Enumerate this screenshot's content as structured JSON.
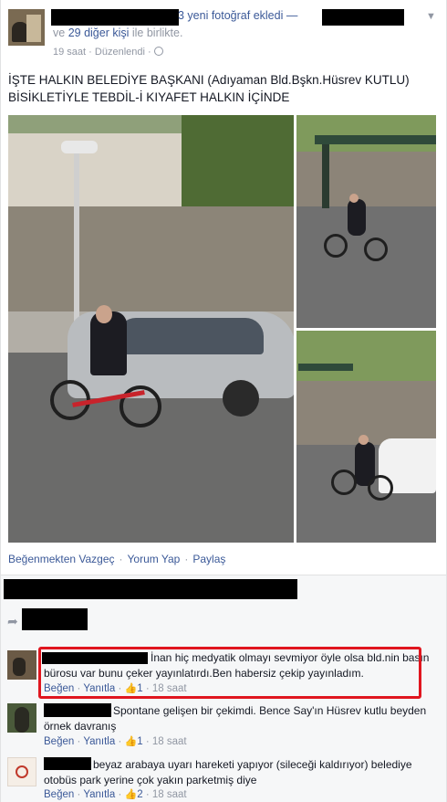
{
  "post": {
    "header_action": "3 yeni fotoğraf ekledi —",
    "with_prefix": "ve",
    "with_count": "29 diğer kişi",
    "with_suffix": "ile birlikte.",
    "time": "19 saat",
    "meta_sep": "·",
    "edited": "Düzenlendi",
    "text": "İŞTE HALKIN BELEDİYE BAŞKANI (Adıyaman Bld.Bşkn.Hüsrev KUTLU) BİSİKLETİYLE TEBDİL-İ KIYAFET HALKIN İÇİNDE",
    "actions": {
      "unlike": "Beğenmekten Vazgeç",
      "comment": "Yorum Yap",
      "share": "Paylaş",
      "sep": "·"
    }
  },
  "comments": [
    {
      "text": "İnan hiç medyatik olmayı sevmiyor öyle olsa bld.nin basın bürosu var bunu çeker yayınlatırdı.Ben habersiz çekip yayınladım.",
      "like": "Beğen",
      "reply": "Yanıtla",
      "likes": "1",
      "time": "18 saat",
      "highlighted": true
    },
    {
      "text": "Spontane gelişen bir çekimdi. Bence Say'ın Hüsrev kutlu beyden örnek davranış",
      "like": "Beğen",
      "reply": "Yanıtla",
      "likes": "1",
      "time": "18 saat"
    },
    {
      "text": "beyaz arabaya uyarı hareketi yapıyor (sileceği kaldırıyor) belediye otobüs park yerine çok yakın parketmiş diye",
      "like": "Beğen",
      "reply": "Yanıtla",
      "likes": "2",
      "time": "18 saat"
    }
  ],
  "meta_sep": "·",
  "icons": {
    "globe": "globe-icon",
    "chevron": "chevron-down-icon",
    "share": "share-arrow-icon",
    "thumb": "thumbs-up-icon"
  },
  "colors": {
    "link": "#3b5998",
    "muted": "#9197a3",
    "highlight": "#e0161f"
  }
}
